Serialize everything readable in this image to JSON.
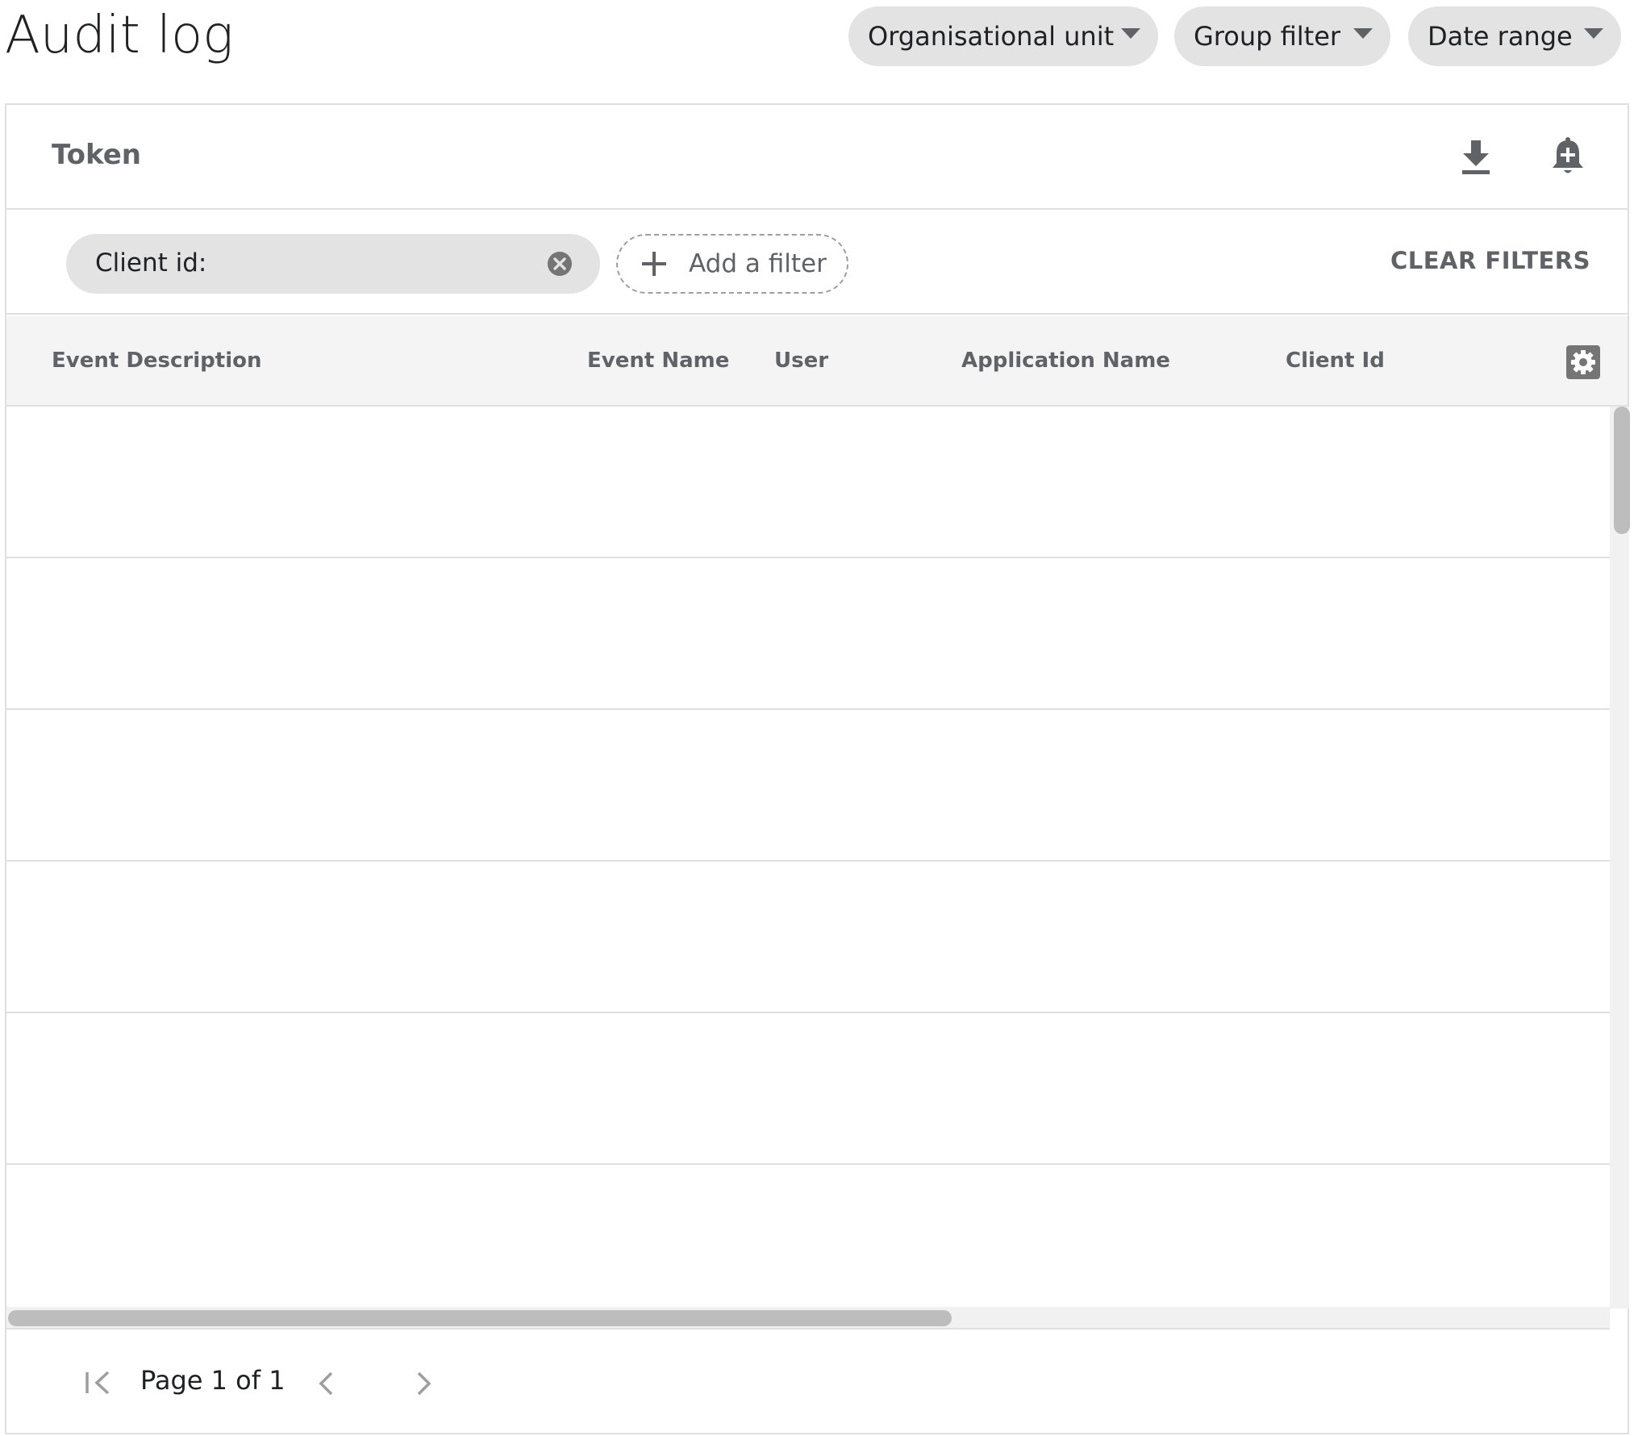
{
  "page": {
    "title": "Audit log"
  },
  "toolbar": {
    "filters": [
      {
        "label": "Organisational unit",
        "icon": "arrow-drop-down-icon"
      },
      {
        "label": "Group filter",
        "icon": "arrow-drop-down-icon"
      },
      {
        "label": "Date range",
        "icon": "arrow-drop-down-icon"
      }
    ]
  },
  "card": {
    "title": "Token",
    "actions": [
      {
        "icon": "download-icon"
      },
      {
        "icon": "add-alert-icon"
      }
    ]
  },
  "filter_bar": {
    "active_filter_label": "Client id:",
    "add_filter_label": "Add a filter",
    "clear_filters_label": "CLEAR FILTERS"
  },
  "table": {
    "columns": [
      "Event Description",
      "Event Name",
      "User",
      "Application Name",
      "Client Id"
    ],
    "settings_icon": "gear-icon",
    "rows": [
      {},
      {},
      {},
      {},
      {},
      {}
    ]
  },
  "pagination": {
    "label": "Page 1 of 1",
    "icons": [
      "first-page-icon",
      "chevron-left-icon",
      "chevron-right-icon"
    ]
  },
  "colors": {
    "chip_background": "#e3e3e3",
    "header_background": "#f4f4f4",
    "muted_text": "#5f6368",
    "divider": "#e0e0e0"
  }
}
